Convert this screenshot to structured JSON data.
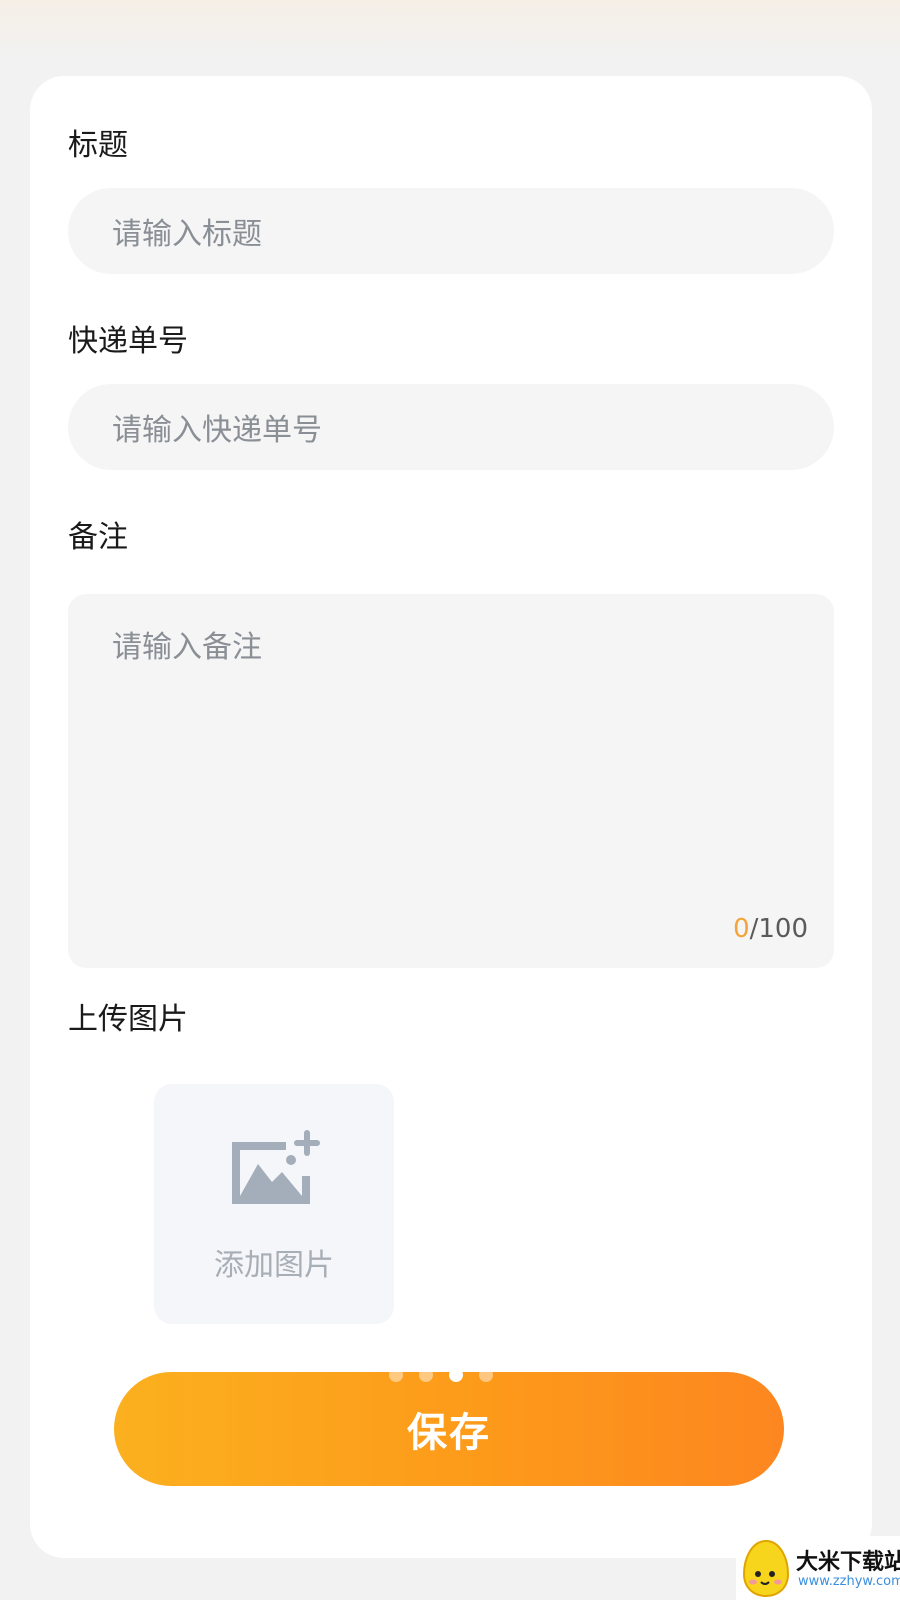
{
  "form": {
    "title_label": "标题",
    "title_placeholder": "请输入标题",
    "tracking_label": "快递单号",
    "tracking_placeholder": "请输入快递单号",
    "remark_label": "备注",
    "remark_placeholder": "请输入备注",
    "remark_count_current": "0",
    "remark_count_max": "/100",
    "upload_label": "上传图片",
    "add_image_text": "添加图片",
    "save_label": "保存"
  },
  "pager": {
    "count": 4,
    "active_index": 2
  },
  "watermark": {
    "title": "大米下载站",
    "url": "www.zzhyw.com"
  },
  "colors": {
    "accent": "#fd9a1a",
    "counter_current": "#f3a33a",
    "field_bg": "#f5f5f5"
  },
  "icons": {
    "upload": "image-add-icon"
  }
}
